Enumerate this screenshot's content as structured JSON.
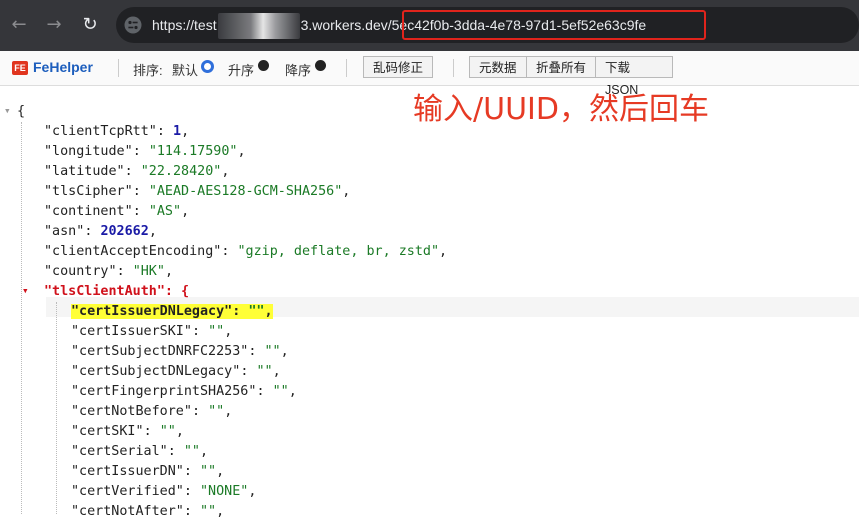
{
  "browser": {
    "url_prefix": "https://test",
    "url_domain": "3.workers.dev",
    "url_path": "/5ec42f0b-3dda-4e78-97d1-5ef52e63c9fe"
  },
  "fehelper": {
    "name": "FeHelper",
    "sort_label": "排序:",
    "opt_default": "默认",
    "opt_asc": "升序",
    "opt_desc": "降序",
    "btn_fix": "乱码修正",
    "btn_meta": "元数据",
    "btn_fold": "折叠所有",
    "btn_download": "下载JSON"
  },
  "annotation": "输入/UUID，然后回车",
  "json": {
    "open": "{",
    "rows": [
      {
        "key": "\"clientTcpRtt\"",
        "sep": ": ",
        "val": "1",
        "type": "n"
      },
      {
        "key": "\"longitude\"",
        "sep": ": ",
        "val": "\"114.17590\"",
        "type": "s"
      },
      {
        "key": "\"latitude\"",
        "sep": ": ",
        "val": "\"22.28420\"",
        "type": "s"
      },
      {
        "key": "\"tlsCipher\"",
        "sep": ": ",
        "val": "\"AEAD-AES128-GCM-SHA256\"",
        "type": "s"
      },
      {
        "key": "\"continent\"",
        "sep": ": ",
        "val": "\"AS\"",
        "type": "s"
      },
      {
        "key": "\"asn\"",
        "sep": ": ",
        "val": "202662",
        "type": "n"
      },
      {
        "key": "\"clientAcceptEncoding\"",
        "sep": ": ",
        "val": "\"gzip, deflate, br, zstd\"",
        "type": "s"
      },
      {
        "key": "\"country\"",
        "sep": ": ",
        "val": "\"HK\"",
        "type": "s"
      }
    ],
    "nested_key": "\"tlsClientAuth\": {",
    "nested_rows": [
      {
        "key": "\"certIssuerDNLegacy\"",
        "sep": ": ",
        "val": "\"\""
      },
      {
        "key": "\"certIssuerSKI\"",
        "sep": ": ",
        "val": "\"\""
      },
      {
        "key": "\"certSubjectDNRFC2253\"",
        "sep": ": ",
        "val": "\"\""
      },
      {
        "key": "\"certSubjectDNLegacy\"",
        "sep": ": ",
        "val": "\"\""
      },
      {
        "key": "\"certFingerprintSHA256\"",
        "sep": ": ",
        "val": "\"\""
      },
      {
        "key": "\"certNotBefore\"",
        "sep": ": ",
        "val": "\"\""
      },
      {
        "key": "\"certSKI\"",
        "sep": ": ",
        "val": "\"\""
      },
      {
        "key": "\"certSerial\"",
        "sep": ": ",
        "val": "\"\""
      },
      {
        "key": "\"certIssuerDN\"",
        "sep": ": ",
        "val": "\"\""
      },
      {
        "key": "\"certVerified\"",
        "sep": ": ",
        "val": "\"NONE\""
      },
      {
        "key": "\"certNotAfter\"",
        "sep": ": ",
        "val": "\"\""
      }
    ],
    "comma": ","
  }
}
